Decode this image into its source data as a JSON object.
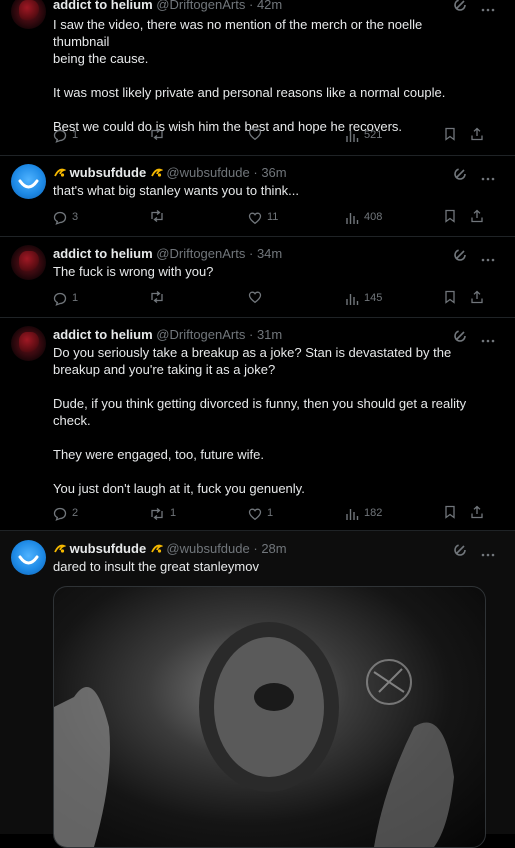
{
  "tweets": [
    {
      "author": "addict to helium",
      "handle": "@DriftogenArts",
      "time": "42m",
      "lines": [
        "I saw the video, there was no mention of the merch or the noelle thumbnail",
        "being the cause.",
        "",
        "It was most likely private and personal reasons like a normal couple.",
        "",
        "Best we could do is wish him the best and hope he recovers."
      ],
      "replies": "1",
      "reposts": "",
      "likes": "",
      "views": "521"
    },
    {
      "author": "wubsufdude",
      "handle": "@wubsufdude",
      "time": "36m",
      "lines": [
        "that's what big stanley wants you to think..."
      ],
      "replies": "3",
      "reposts": "",
      "likes": "11",
      "views": "408"
    },
    {
      "author": "addict to helium",
      "handle": "@DriftogenArts",
      "time": "34m",
      "lines": [
        "The fuck is wrong with you?"
      ],
      "replies": "1",
      "reposts": "",
      "likes": "",
      "views": "145"
    },
    {
      "author": "addict to helium",
      "handle": "@DriftogenArts",
      "time": "31m",
      "lines": [
        "Do you seriously take a breakup as a joke? Stan is devastated by the",
        "breakup and you're taking it as a joke?",
        "",
        "Dude, if you think getting divorced is funny, then you should get a reality",
        "check.",
        "",
        "They were engaged, too, future wife.",
        "",
        "You just don't laugh at it, fuck you genuenly."
      ],
      "replies": "2",
      "reposts": "1",
      "likes": "1",
      "views": "182"
    },
    {
      "author": "wubsufdude",
      "handle": "@wubsufdude",
      "time": "28m",
      "lines": [
        "dared to insult the great stanleymov"
      ]
    }
  ],
  "icons": {
    "reply": "reply-icon",
    "repost": "repost-icon",
    "like": "like-icon",
    "views": "views-icon",
    "bookmark": "bookmark-icon",
    "share": "share-icon",
    "grok": "grok-icon",
    "more": "more-icon"
  },
  "colors": {
    "background": "#000000",
    "text": "#e7e9ea",
    "muted": "#71767b"
  }
}
